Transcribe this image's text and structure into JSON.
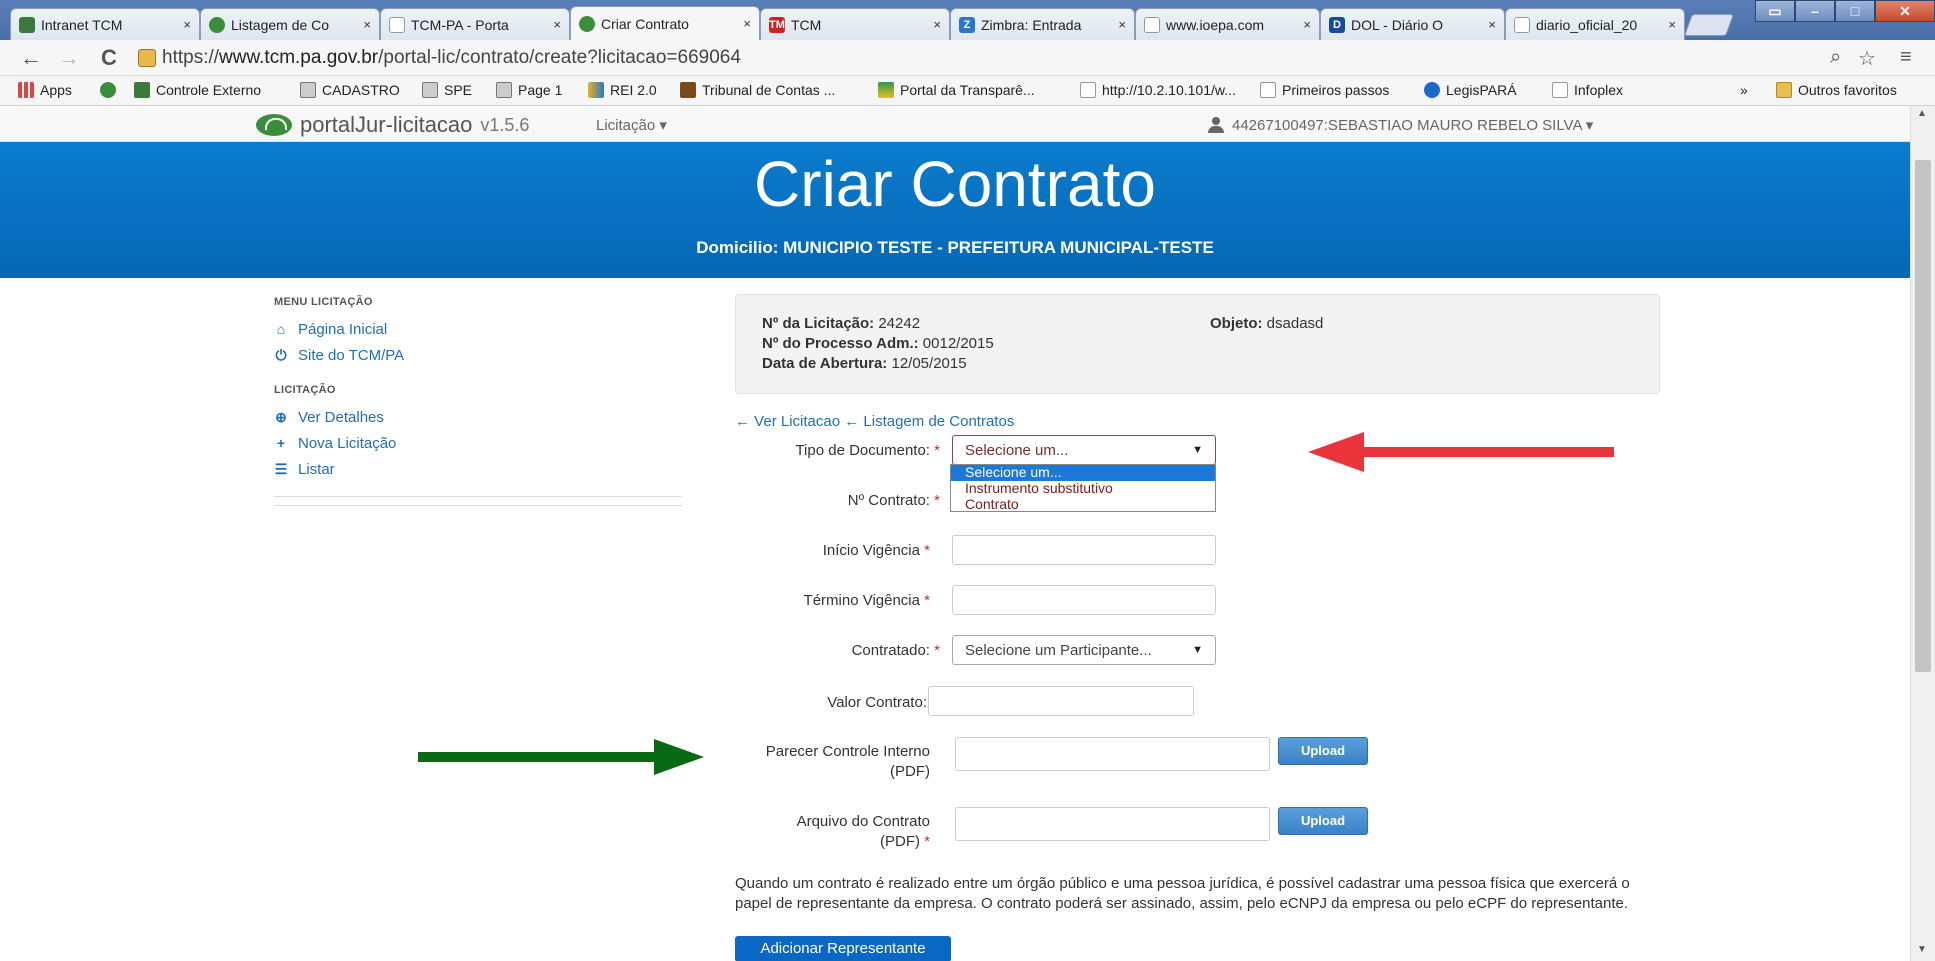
{
  "browser": {
    "tabs": [
      {
        "label": "Intranet TCM",
        "icon_color": "#3b7a3b"
      },
      {
        "label": "Listagem de Co",
        "icon_color": "#3a8d3a"
      },
      {
        "label": "TCM-PA - Porta",
        "icon_color": "#ffffff"
      },
      {
        "label": "Criar Contrato",
        "icon_color": "#3a8d3a",
        "active": true
      },
      {
        "label": "TCM",
        "icon_color": "#cc2222"
      },
      {
        "label": "Zimbra: Entrada",
        "icon_color": "#2a78c8"
      },
      {
        "label": "www.ioepa.com",
        "icon_color": "#ffffff"
      },
      {
        "label": "DOL - Diário O",
        "icon_color": "#1a4a9a"
      },
      {
        "label": "diario_oficial_20",
        "icon_color": "#ffffff"
      }
    ],
    "tab_close": "×",
    "tab_icon_texts": {
      "tcm": "TM",
      "zimbra": "Z",
      "dol": "D"
    },
    "url_scheme": "https://",
    "url_host": "www.tcm.pa.gov.br",
    "url_path": "/portal-lic/contrato/create?licitacao=669064",
    "bookmarks": [
      {
        "label": "Apps",
        "icon": "apps-grid-icon",
        "color": "#d44"
      },
      {
        "label": "",
        "icon": "portal-logo-icon",
        "color": "#3a8d3a"
      },
      {
        "label": "Controle Externo",
        "icon": "tcm-icon",
        "color": "#3b7a3b"
      },
      {
        "label": "CADASTRO",
        "icon": "chart-icon",
        "color": "#777"
      },
      {
        "label": "SPE",
        "icon": "chart-icon",
        "color": "#777"
      },
      {
        "label": "Page 1",
        "icon": "chart-icon",
        "color": "#777"
      },
      {
        "label": "REI 2.0",
        "icon": "arrow-icon",
        "color": "#e8b020"
      },
      {
        "label": "Tribunal de Contas ...",
        "icon": "tribunal-icon",
        "color": "#7a4a1a"
      },
      {
        "label": "Portal da Transparê...",
        "icon": "flag-icon",
        "color": "#2a9a4a"
      },
      {
        "label": "http://10.2.10.101/w...",
        "icon": "page-icon",
        "color": "#ffffff"
      },
      {
        "label": "Primeiros passos",
        "icon": "page-icon",
        "color": "#ffffff"
      },
      {
        "label": "LegisPARÁ",
        "icon": "legis-icon",
        "color": "#1a6ac8"
      },
      {
        "label": "Infoplex",
        "icon": "page-icon",
        "color": "#ffffff"
      }
    ],
    "bookmarks_overflow": "»",
    "other_bookmarks": "Outros favoritos"
  },
  "navbar": {
    "brand": "portalJur-licitacao",
    "version": "v1.5.6",
    "menu": "Licitação ▾",
    "user": "44267100497:SEBASTIAO MAURO REBELO SILVA ▾"
  },
  "banner": {
    "title": "Criar Contrato",
    "subtitle": "Domicilio: MUNICIPIO TESTE - PREFEITURA MUNICIPAL-TESTE"
  },
  "sidebar": {
    "menu_heading": "MENU LICITAÇÃO",
    "menu_items": [
      {
        "label": "Página Inicial",
        "icon": "home-icon"
      },
      {
        "label": "Site do TCM/PA",
        "icon": "power-icon"
      }
    ],
    "section_heading": "LICITAÇÃO",
    "section_items": [
      {
        "label": "Ver Detalhes",
        "icon": "zoom-icon"
      },
      {
        "label": "Nova Licitação",
        "icon": "plus-icon"
      },
      {
        "label": "Listar",
        "icon": "list-icon"
      }
    ]
  },
  "info": {
    "licitacao_label": "Nº da Licitação:",
    "licitacao_value": "24242",
    "processo_label": "Nº do Processo Adm.:",
    "processo_value": "0012/2015",
    "abertura_label": "Data de Abertura:",
    "abertura_value": "12/05/2015",
    "objeto_label": "Objeto:",
    "objeto_value": "dsadasd"
  },
  "form": {
    "link_ver": "Ver Licitacao",
    "link_listagem": "Listagem de Contratos",
    "tipo_label": "Tipo de Documento:",
    "tipo_value": "Selecione um...",
    "tipo_options": [
      "Selecione um...",
      "Instrumento substitutivo",
      "Contrato"
    ],
    "contrato_label": "Nº Contrato:",
    "inicio_label": "Início Vigência",
    "termino_label": "Término Vigência",
    "contratado_label": "Contratado:",
    "contratado_value": "Selecione um Participante...",
    "valor_label": "Valor Contrato:",
    "parecer_label_1": "Parecer Controle Interno",
    "parecer_label_2": "(PDF)",
    "arquivo_label_1": "Arquivo do Contrato",
    "arquivo_label_2": "(PDF)",
    "required_mark": "*",
    "upload_label": "Upload",
    "note": "Quando um contrato é realizado entre um órgão público e uma pessoa jurídica, é possível cadastrar uma pessoa física que exercerá o papel de representante da empresa. O contrato poderá ser assinado, assim, pelo eCNPJ da empresa ou pelo eCPF do representante.",
    "add_rep": "Adicionar Representante"
  },
  "annotations": {
    "red_arrow_color": "#e8343a",
    "green_arrow_color": "#0a6a14"
  }
}
